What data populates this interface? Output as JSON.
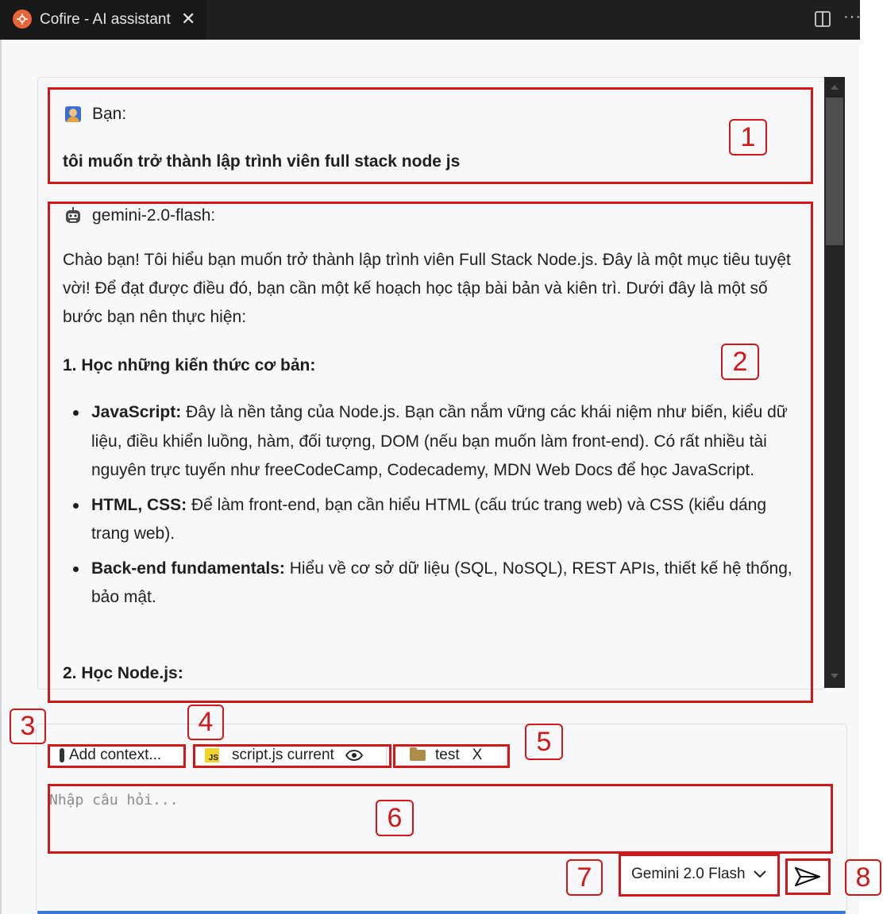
{
  "tab": {
    "title": "Cofire - AI assistant",
    "close": "✕"
  },
  "titlebar": {
    "more": "···"
  },
  "chat": {
    "user": {
      "label": "Bạn:",
      "message": "tôi muốn trở thành lập trình viên full stack node js"
    },
    "bot": {
      "label": "gemini-2.0-flash:",
      "intro": "Chào bạn! Tôi hiểu bạn muốn trở thành lập trình viên Full Stack Node.js. Đây là một mục tiêu tuyệt vời! Để đạt được điều đó, bạn cần một kế hoạch học tập bài bản và kiên trì. Dưới đây là một số bước bạn nên thực hiện:",
      "section1": "1. Học những kiến thức cơ bản:",
      "bullets": [
        {
          "term": "JavaScript:",
          "text": " Đây là nền tảng của Node.js. Bạn cần nắm vững các khái niệm như biến, kiểu dữ liệu, điều khiển luồng, hàm, đối tượng, DOM (nếu bạn muốn làm front-end). Có rất nhiều tài nguyên trực tuyến như freeCodeCamp, Codecademy, MDN Web Docs để học JavaScript."
        },
        {
          "term": "HTML, CSS:",
          "text": " Để làm front-end, bạn cần hiểu HTML (cấu trúc trang web) và CSS (kiểu dáng trang web)."
        },
        {
          "term": "Back-end fundamentals:",
          "text": " Hiểu về cơ sở dữ liệu (SQL, NoSQL), REST APIs, thiết kế hệ thống, bảo mật."
        }
      ],
      "section2": "2. Học Node.js:"
    }
  },
  "input": {
    "add_context": "Add context...",
    "file_chip": {
      "badge": "JS",
      "label": "script.js current"
    },
    "folder_chip": {
      "label": "test",
      "remove": "X"
    },
    "placeholder": "Nhập câu hỏi...",
    "model": "Gemini 2.0 Flash"
  },
  "annotations": [
    "1",
    "2",
    "3",
    "4",
    "5",
    "6",
    "7",
    "8"
  ],
  "colors": {
    "annotation": "#d01818",
    "tab_icon": "#e8643a",
    "js_badge": "#f2d32b",
    "accent": "#3a78d8"
  }
}
